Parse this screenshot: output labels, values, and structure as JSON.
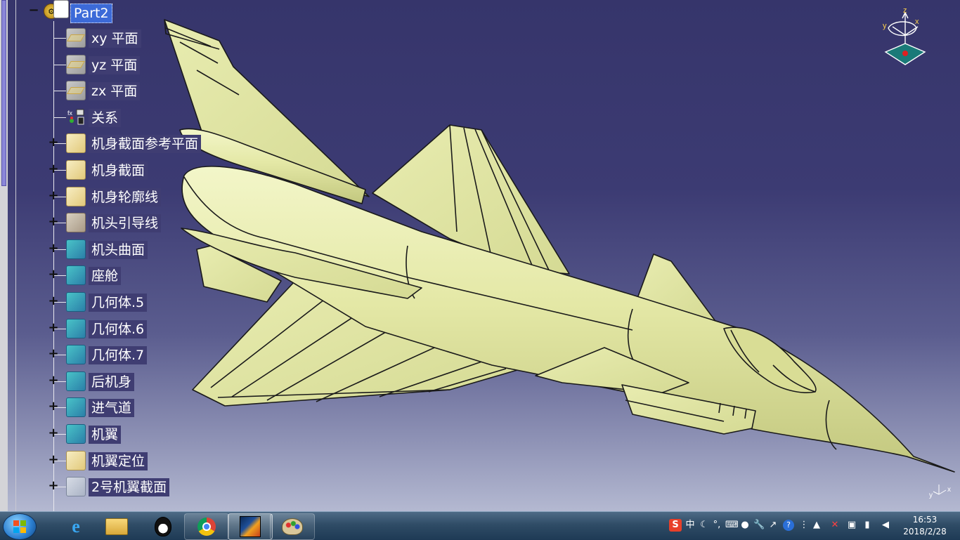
{
  "tree": {
    "root": {
      "label": "Part2"
    },
    "items": [
      {
        "label": "xy 平面",
        "kind": "plane"
      },
      {
        "label": "yz 平面",
        "kind": "plane"
      },
      {
        "label": "zx 平面",
        "kind": "plane"
      },
      {
        "label": "关系",
        "kind": "relations"
      },
      {
        "label": "机身截面参考平面",
        "kind": "geoset"
      },
      {
        "label": "机身截面",
        "kind": "geoset"
      },
      {
        "label": "机身轮廓线",
        "kind": "geoset"
      },
      {
        "label": "机头引导线",
        "kind": "guide"
      },
      {
        "label": "机头曲面",
        "kind": "body"
      },
      {
        "label": "座舱",
        "kind": "body"
      },
      {
        "label": "几何体.5",
        "kind": "body"
      },
      {
        "label": "几何体.6",
        "kind": "body"
      },
      {
        "label": "几何体.7",
        "kind": "body"
      },
      {
        "label": "后机身",
        "kind": "body"
      },
      {
        "label": "进气道",
        "kind": "body"
      },
      {
        "label": "机翼",
        "kind": "body"
      },
      {
        "label": "机翼定位",
        "kind": "geoset"
      },
      {
        "label": "2号机翼截面",
        "kind": "sect2"
      }
    ]
  },
  "compass": {
    "x": "x",
    "y": "y",
    "z": "z"
  },
  "mini_axis": {
    "x": "x",
    "y": "y"
  },
  "colors": {
    "model": "#e8ecae",
    "edge": "#1a1a1a",
    "selection": "#3c6ad8"
  },
  "taskbar": {
    "items": [
      {
        "name": "ie-icon"
      },
      {
        "name": "explorer-icon"
      },
      {
        "name": "qq-icon"
      },
      {
        "name": "chrome-icon"
      },
      {
        "name": "catia-icon"
      },
      {
        "name": "paint-icon"
      }
    ],
    "tray": {
      "ime_lang": "中"
    },
    "clock": {
      "time": "16:53",
      "date": "2018/2/28"
    }
  }
}
